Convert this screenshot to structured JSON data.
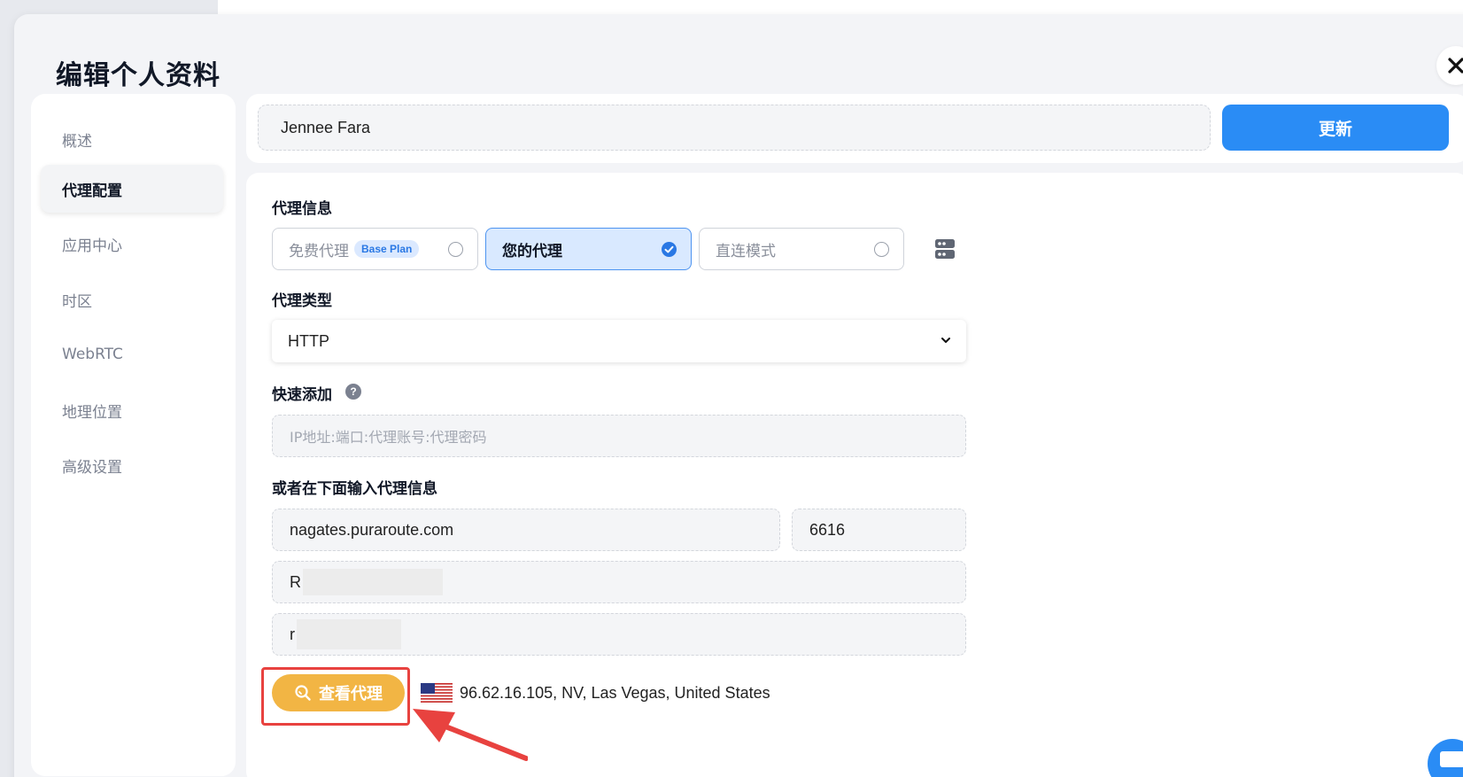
{
  "modal": {
    "title": "编辑个人资料"
  },
  "sidebar": {
    "items": [
      {
        "label": "概述",
        "active": false
      },
      {
        "label": "代理配置",
        "active": true
      },
      {
        "label": "应用中心",
        "active": false
      },
      {
        "label": "时区",
        "active": false
      },
      {
        "label": "WebRTC",
        "active": false
      },
      {
        "label": "地理位置",
        "active": false
      },
      {
        "label": "高级设置",
        "active": false
      }
    ]
  },
  "profile": {
    "name": "Jennee Fara",
    "update_label": "更新"
  },
  "proxy_info": {
    "label": "代理信息",
    "options": [
      {
        "label": "免费代理",
        "badge": "Base Plan",
        "selected": false
      },
      {
        "label": "您的代理",
        "selected": true
      },
      {
        "label": "直连模式",
        "selected": false
      }
    ]
  },
  "proxy_type": {
    "label": "代理类型",
    "value": "HTTP"
  },
  "quick_add": {
    "label": "快速添加",
    "help": "?",
    "placeholder": "IP地址:端口:代理账号:代理密码"
  },
  "manual": {
    "label": "或者在下面输入代理信息",
    "host": "nagates.puraroute.com",
    "port": "6616",
    "username": "R",
    "password": "r"
  },
  "check": {
    "label": "查看代理",
    "result": "96.62.16.105, NV, Las Vegas, United States"
  },
  "colors": {
    "accent": "#2a8cf5",
    "check_button": "#f2b544",
    "highlight": "#e8423f"
  }
}
